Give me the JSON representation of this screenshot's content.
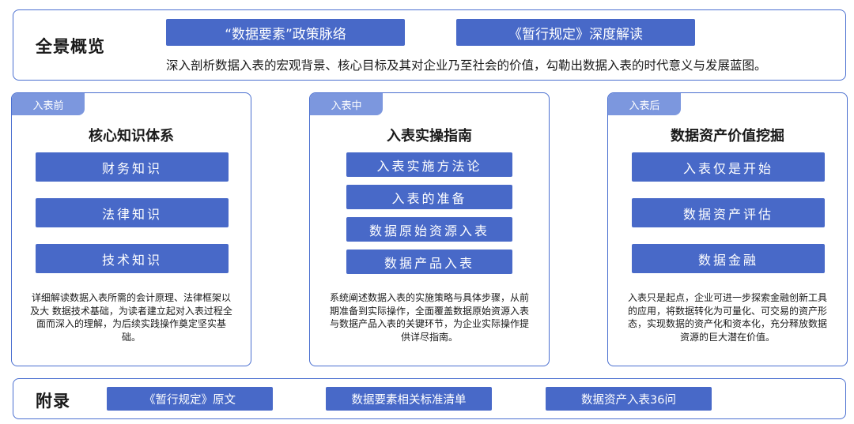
{
  "overview": {
    "title": "全景概览",
    "buttons": [
      "“数据要素”政策脉络",
      "《暂行规定》深度解读"
    ],
    "description": "深入剖析数据入表的宏观背景、核心目标及其对企业乃至社会的价值，勾勒出数据入表的时代意义与发展蓝图。"
  },
  "stages": [
    {
      "tag": "入表前",
      "title": "核心知识体系",
      "items": [
        "财务知识",
        "法律知识",
        "技术知识"
      ],
      "description": "详细解读数据入表所需的会计原理、法律框架以及大 数据技术基础，为读者建立起对入表过程全面而深入的理解，为后续实践操作奠定坚实基础。"
    },
    {
      "tag": "入表中",
      "title": "入表实操指南",
      "items": [
        "入表实施方法论",
        "入表的准备",
        "数据原始资源入表",
        "数据产品入表"
      ],
      "description": "系统阐述数据入表的实施策略与具体步骤，从前期准备到实际操作，全面覆盖数据原始资源入表与数据产品入表的关键环节，为企业实际操作提供详尽指南。"
    },
    {
      "tag": "入表后",
      "title": "数据资产价值挖掘",
      "items": [
        "入表仅是开始",
        "数据资产评估",
        "数据金融"
      ],
      "description": "入表只是起点，企业可进一步探索金融创新工具的应用，将数据转化为可量化、可交易的资产形态，实现数据的资产化和资本化，充分释放数据资源的巨大潜在价值。"
    }
  ],
  "appendix": {
    "title": "附录",
    "buttons": [
      "《暂行规定》原文",
      "数据要素相关标准清单",
      "数据资产入表36问"
    ]
  },
  "colors": {
    "border": "#4a6fd0",
    "button": "#4869c8",
    "tag": "#7c97de"
  }
}
